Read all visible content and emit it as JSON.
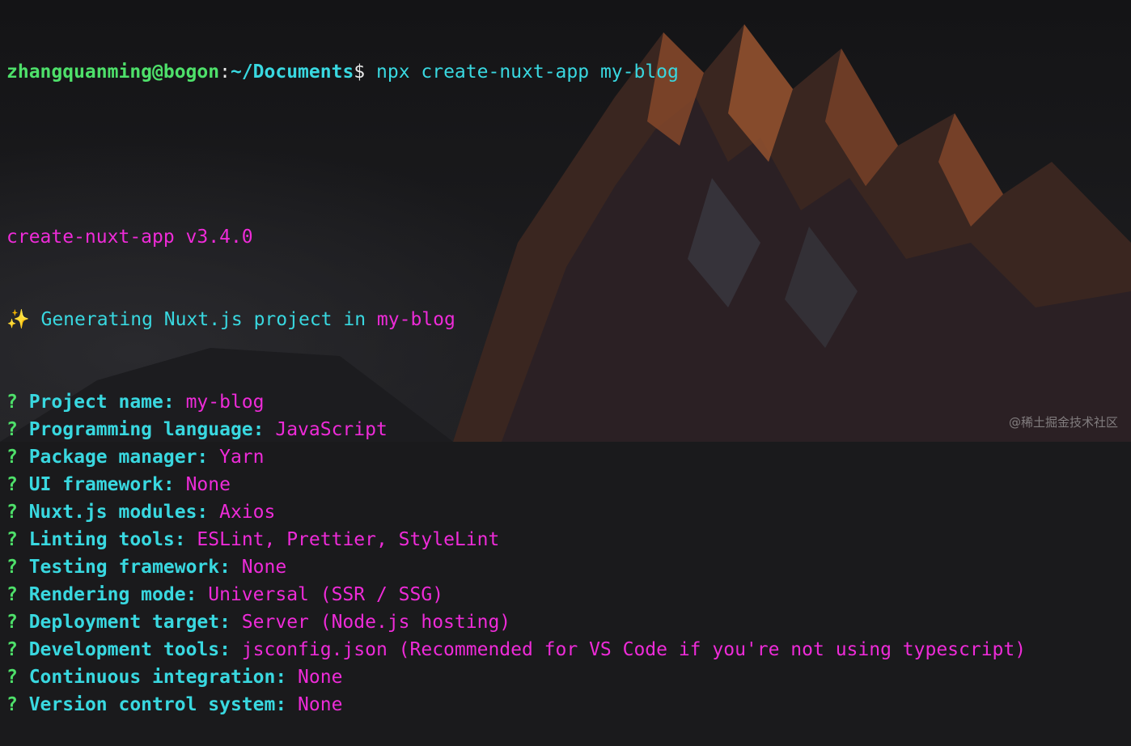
{
  "prompt": {
    "user_host": "zhangquanming@bogon",
    "sep": ":",
    "path": "~/Documents",
    "symbol": "$",
    "command": " npx create-nuxt-app my-blog"
  },
  "version_line": "create-nuxt-app v3.4.0",
  "generating": {
    "icon": "✨",
    "text": " Generating Nuxt.js project in ",
    "project": "my-blog"
  },
  "questions": [
    {
      "mark": "? ",
      "label": "Project name:",
      "answer": " my-blog"
    },
    {
      "mark": "? ",
      "label": "Programming language:",
      "answer": " JavaScript"
    },
    {
      "mark": "? ",
      "label": "Package manager:",
      "answer": " Yarn"
    },
    {
      "mark": "? ",
      "label": "UI framework:",
      "answer": " None"
    },
    {
      "mark": "? ",
      "label": "Nuxt.js modules:",
      "answer": " Axios"
    },
    {
      "mark": "? ",
      "label": "Linting tools:",
      "answer": " ESLint, Prettier, StyleLint"
    },
    {
      "mark": "? ",
      "label": "Testing framework:",
      "answer": " None"
    },
    {
      "mark": "? ",
      "label": "Rendering mode:",
      "answer": " Universal (SSR / SSG)"
    },
    {
      "mark": "? ",
      "label": "Deployment target:",
      "answer": " Server (Node.js hosting)"
    },
    {
      "mark": "? ",
      "label": "Development tools:",
      "answer": " jsconfig.json (Recommended for VS Code if you're not using typescript)"
    },
    {
      "mark": "? ",
      "label": "Continuous integration:",
      "answer": " None"
    },
    {
      "mark": "? ",
      "label": "Version control system:",
      "answer": " None"
    }
  ],
  "watermark": "@稀土掘金技术社区",
  "colors": {
    "prompt_green": "#4ee06a",
    "accent_cyan": "#39d8e0",
    "answer_magenta": "#ee2bd8"
  }
}
